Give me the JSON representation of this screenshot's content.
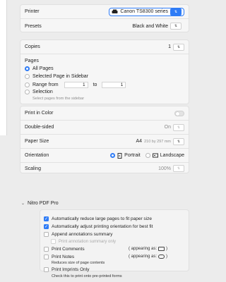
{
  "printer": {
    "label": "Printer",
    "value": "Canon TS8300 series"
  },
  "presets": {
    "label": "Presets",
    "value": "Black and White"
  },
  "copies": {
    "label": "Copies",
    "value": "1"
  },
  "pages": {
    "label": "Pages",
    "all": "All Pages",
    "selected": "Selected Page in Sidebar",
    "range_label": "Range from",
    "range_from": "1",
    "range_to_label": "to",
    "range_to": "1",
    "selection": "Selection",
    "selection_hint": "Select pages from the sidebar"
  },
  "print_in_color": {
    "label": "Print in Color"
  },
  "double_sided": {
    "label": "Double-sided",
    "value": "On"
  },
  "paper_size": {
    "label": "Paper Size",
    "value": "A4",
    "dimensions": "210 by 297 mm"
  },
  "orientation": {
    "label": "Orientation",
    "portrait": "Portrait",
    "landscape": "Landscape"
  },
  "scaling": {
    "label": "Scaling",
    "value": "100%"
  },
  "nitro": {
    "title": "Nitro PDF Pro",
    "reduce": "Automatically reduce large pages to fit paper size",
    "adjust": "Automatically adjust printing orientation for best fit",
    "append": "Append annotations summary",
    "annot_only": "Print annotation summary only",
    "comments": "Print Comments",
    "appearing1": "( appearing as:",
    "appearing1_close": ")",
    "notes": "Print Notes",
    "appearing2": "( appearing as:",
    "appearing2_close": ")",
    "notes_hint": "Reduces size of page contents",
    "imprints": "Print Imprints Only",
    "imprints_hint": "Check this to print onto pre-printed forms"
  },
  "colors": {
    "accent": "#2f7cf6",
    "panel": "#f6f6f6",
    "background": "#ececec"
  },
  "icons": [
    "printer-icon",
    "chevron-updown-icon",
    "chevron-down-icon",
    "portrait-icon",
    "landscape-icon",
    "checkmark-icon"
  ]
}
